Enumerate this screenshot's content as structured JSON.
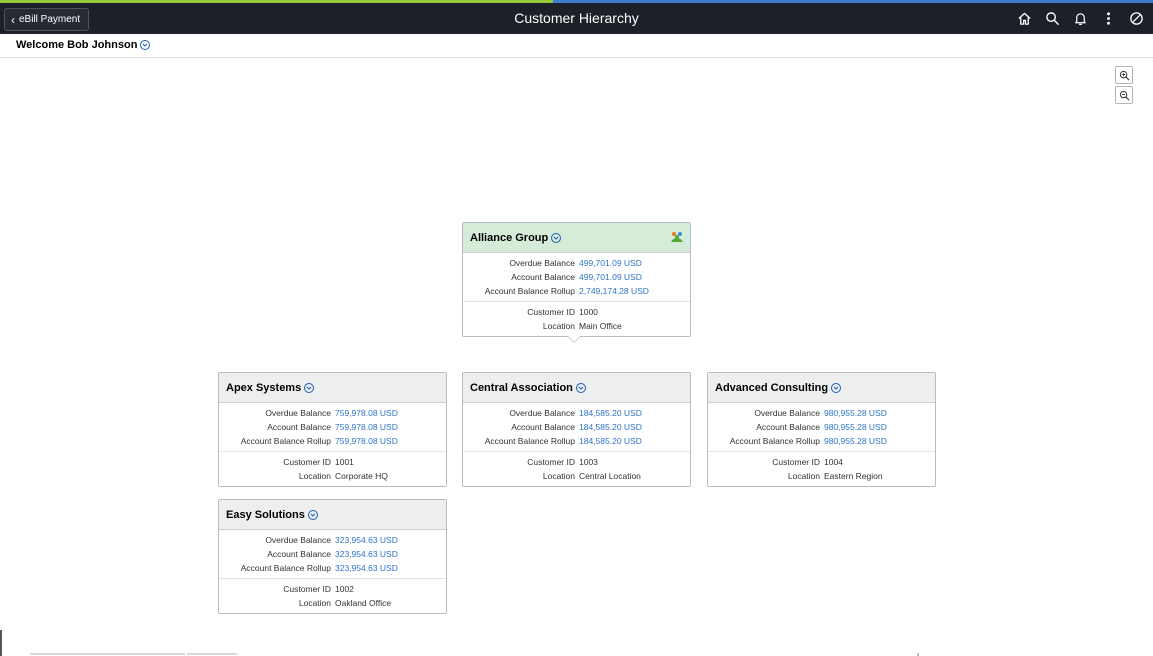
{
  "colors": {
    "topbar_bg": "#1c2129",
    "accent_green": "#97c93d",
    "accent_blue": "#3d7dd0",
    "link_blue": "#2e74c7",
    "root_header": "#d5ecd9",
    "card_header": "#eeeeee"
  },
  "topbar": {
    "back_label": "eBill Payment",
    "title": "Customer Hierarchy",
    "icons": [
      "home-icon",
      "search-icon",
      "bell-icon",
      "more-vertical-icon",
      "navbar-icon"
    ]
  },
  "welcome": {
    "text": "Welcome Bob Johnson"
  },
  "zoom": {
    "in_icon": "zoom-in-icon",
    "out_icon": "zoom-out-icon"
  },
  "labels": {
    "overdue": "Overdue Balance",
    "account": "Account Balance",
    "rollup": "Account Balance Rollup",
    "customer_id": "Customer ID",
    "location": "Location"
  },
  "customers": {
    "alliance": {
      "name": "Alliance Group",
      "overdue": "499,701.09 USD",
      "account": "499,701.09 USD",
      "rollup": "2,749,174.28 USD",
      "customer_id": "1000",
      "location": "Main Office"
    },
    "apex": {
      "name": "Apex Systems",
      "overdue": "759,978.08 USD",
      "account": "759,978.08 USD",
      "rollup": "759,978.08 USD",
      "customer_id": "1001",
      "location": "Corporate HQ"
    },
    "central": {
      "name": "Central Association",
      "overdue": "184,585.20 USD",
      "account": "184,585.20 USD",
      "rollup": "184,585.20 USD",
      "customer_id": "1003",
      "location": "Central Location"
    },
    "advanced": {
      "name": "Advanced Consulting",
      "overdue": "980,955.28 USD",
      "account": "980,955.28 USD",
      "rollup": "980,955.28 USD",
      "customer_id": "1004",
      "location": "Eastern Region"
    },
    "easy": {
      "name": "Easy Solutions",
      "overdue": "323,954.63 USD",
      "account": "323,954.63 USD",
      "rollup": "323,954.63 USD",
      "customer_id": "1002",
      "location": "Oakland Office"
    }
  }
}
